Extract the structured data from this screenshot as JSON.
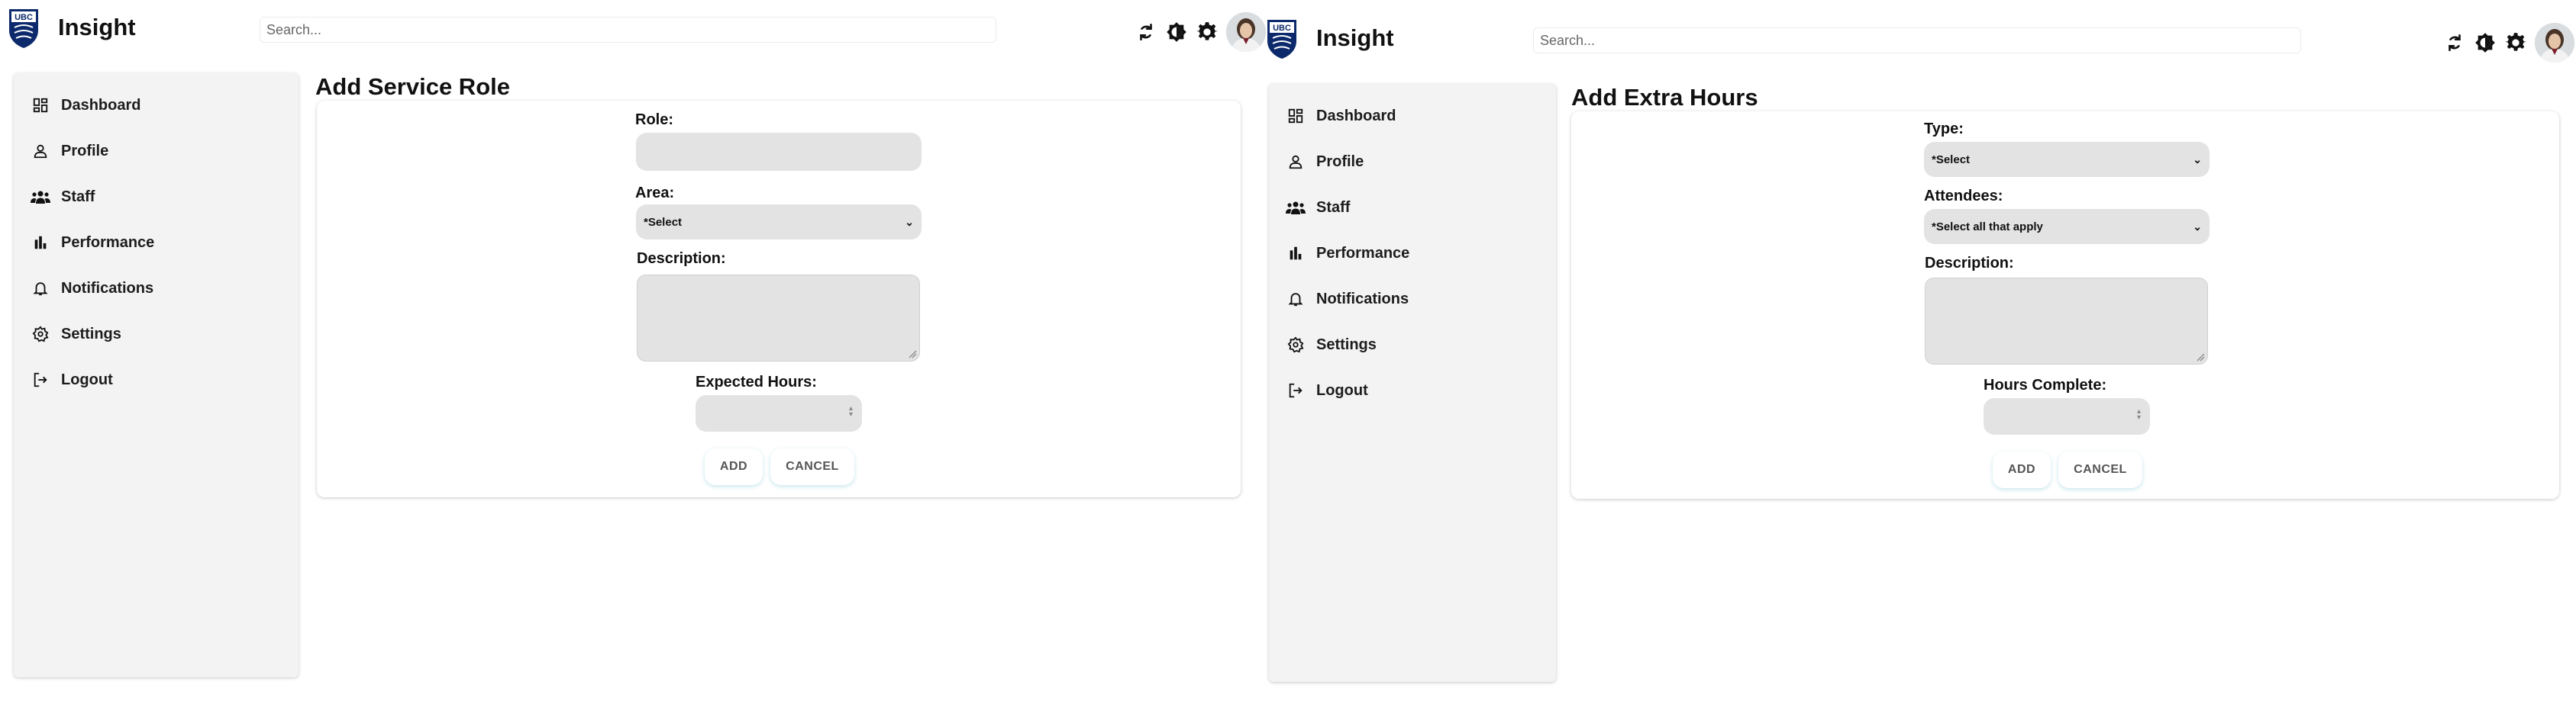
{
  "panes": [
    {
      "app_title": "Insight",
      "search_placeholder": "Search...",
      "nav": [
        "Dashboard",
        "Profile",
        "Staff",
        "Performance",
        "Notifications",
        "Settings",
        "Logout"
      ],
      "page_title": "Add Service Role",
      "form": {
        "role_label": "Role:",
        "area_label": "Area:",
        "area_value": "*Select",
        "description_label": "Description:",
        "hours_label": "Expected Hours:",
        "add_label": "ADD",
        "cancel_label": "CANCEL"
      }
    },
    {
      "app_title": "Insight",
      "search_placeholder": "Search...",
      "nav": [
        "Dashboard",
        "Profile",
        "Staff",
        "Performance",
        "Notifications",
        "Settings",
        "Logout"
      ],
      "page_title": "Add Extra Hours",
      "form": {
        "type_label": "Type:",
        "type_value": "*Select",
        "attendees_label": "Attendees:",
        "attendees_value": "*Select all that apply",
        "description_label": "Description:",
        "hours_label": "Hours Complete:",
        "add_label": "ADD",
        "cancel_label": "CANCEL"
      }
    }
  ],
  "icons": {
    "top": [
      "refresh-icon",
      "brightness-icon",
      "gear-icon"
    ],
    "nav": [
      "dashboard-icon",
      "person-icon",
      "group-icon",
      "bar-chart-icon",
      "bell-icon",
      "gear-icon",
      "logout-icon"
    ]
  },
  "colors": {
    "brand_navy": "#0c2a6b",
    "sidebar_bg": "#f3f3f3",
    "field_bg": "#e3e3e3",
    "button_glow": "#008caa"
  }
}
